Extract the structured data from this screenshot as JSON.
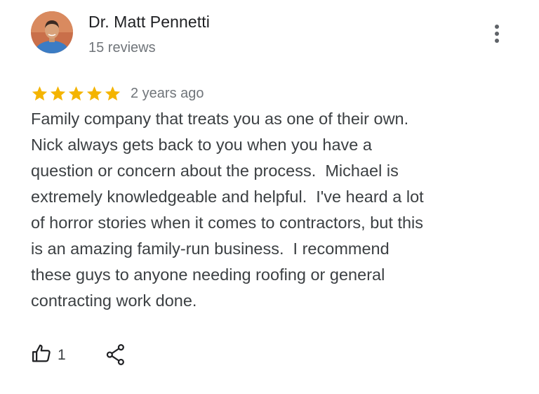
{
  "reviewer": {
    "name": "Dr. Matt Pennetti",
    "reviews_count": "15 reviews"
  },
  "review": {
    "rating": 5,
    "max_rating": 5,
    "star_color": "#F4B400",
    "time": "2 years ago",
    "text_lines": [
      "Family company that treats you as one of their own.",
      "Nick always gets back to you when you have a",
      "question or concern about the process.  Michael is",
      "extremely knowledgeable and helpful.  I've heard a lot",
      "of horror stories when it comes to contractors, but this",
      "is an amazing family-run business.  I recommend",
      "these guys to anyone needing roofing or general",
      "contracting work done."
    ]
  },
  "actions": {
    "like_count": "1",
    "icons": [
      "thumbs-up-icon",
      "share-icon",
      "more-vert-icon"
    ]
  }
}
